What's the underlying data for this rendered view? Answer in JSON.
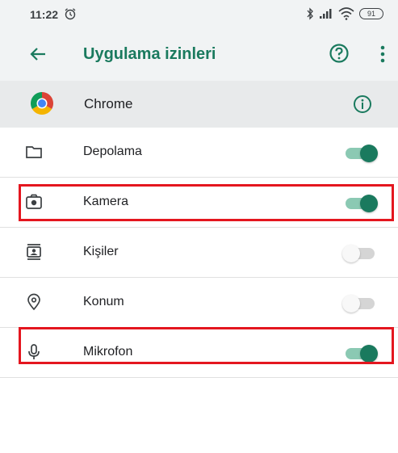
{
  "status_bar": {
    "time": "11:22",
    "battery": "91"
  },
  "app_bar": {
    "title": "Uygulama izinleri"
  },
  "app_header": {
    "name": "Chrome"
  },
  "permissions": [
    {
      "label": "Depolama",
      "icon": "folder-icon",
      "enabled": true
    },
    {
      "label": "Kamera",
      "icon": "camera-icon",
      "enabled": true,
      "highlighted": true
    },
    {
      "label": "Kişiler",
      "icon": "contacts-icon",
      "enabled": false
    },
    {
      "label": "Konum",
      "icon": "location-icon",
      "enabled": false
    },
    {
      "label": "Mikrofon",
      "icon": "microphone-icon",
      "enabled": true,
      "highlighted": true
    }
  ],
  "colors": {
    "accent": "#1a7a5e",
    "highlight": "#e4161f"
  }
}
